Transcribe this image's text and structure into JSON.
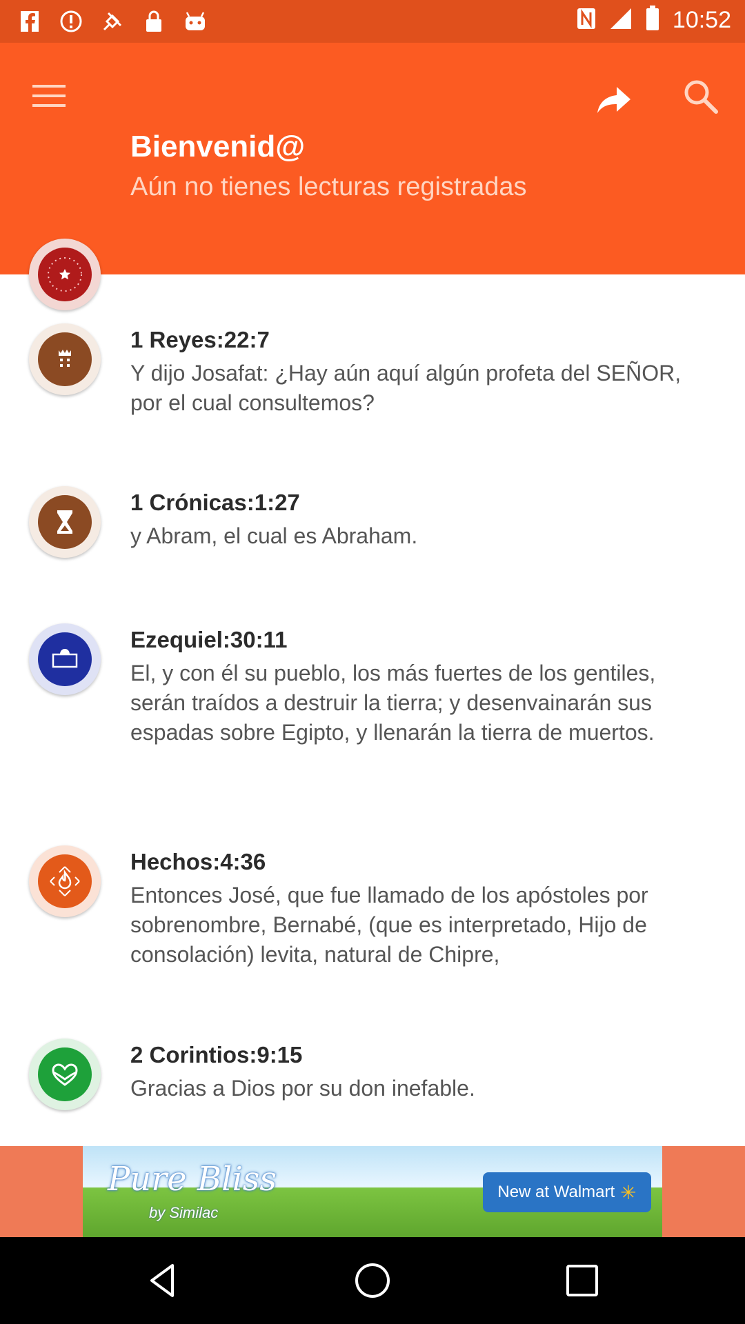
{
  "status_bar": {
    "time": "10:52",
    "left_icons": [
      "facebook-icon",
      "alert-icon",
      "location-icon",
      "lock-icon",
      "android-icon"
    ],
    "right_icons": [
      "nfc-icon",
      "signal-icon",
      "battery-icon"
    ]
  },
  "header": {
    "title": "Bienvenid@",
    "subtitle": "Aún no tienes lecturas registradas",
    "menu_icon": "menu-icon",
    "share_icon": "share-icon",
    "search_icon": "search-icon"
  },
  "readings": [
    {
      "reference": "1 Reyes:22:7",
      "text": "Y dijo Josafat: ¿Hay aún aquí algún profeta del SEÑOR, por el cual consultemos?",
      "icon": "castle-icon",
      "color": "#8b4a23"
    },
    {
      "reference": "1 Crónicas:1:27",
      "text": "y Abram, el cual es Abraham.",
      "icon": "hourglass-icon",
      "color": "#8b4a23"
    },
    {
      "reference": "Ezequiel:30:11",
      "text": "El, y con él su pueblo, los más fuertes de los gentiles, serán traídos a destruir la tierra; y desenvainarán sus espadas sobre Egipto, y llenarán la tierra de muertos.",
      "icon": "ark-icon",
      "color": "#1f2fa0"
    },
    {
      "reference": "Hechos:4:36",
      "text": "Entonces José, que fue llamado de los apóstoles por sobrenombre, Bernabé, (que es interpretado, Hijo de consolación) levita, natural de Chipre,",
      "icon": "flame-icon",
      "color": "#e35a1a"
    },
    {
      "reference": "2 Corintios:9:15",
      "text": "Gracias a Dios por su don inefable.",
      "icon": "heart-icon",
      "color": "#1ea13a"
    }
  ],
  "header_avatar": {
    "icon": "star-icon",
    "color": "#b01b1b"
  },
  "ad": {
    "brand": "Pure Bliss",
    "by": "by Similac",
    "cta": "New at Walmart"
  },
  "nav": [
    "back-icon",
    "home-icon",
    "recents-icon"
  ]
}
